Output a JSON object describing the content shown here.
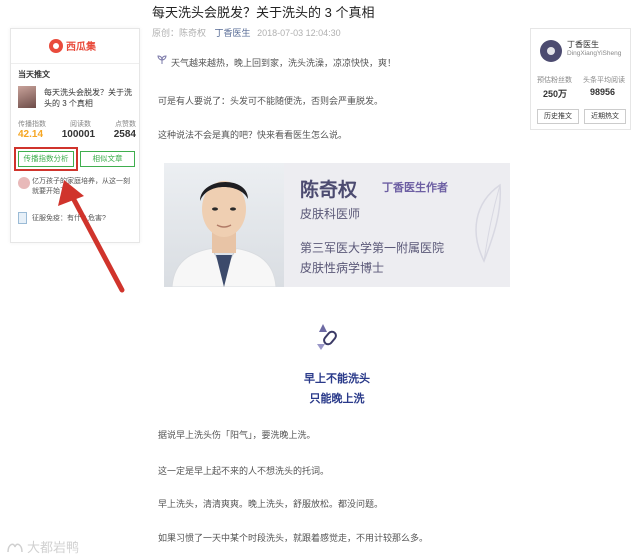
{
  "article": {
    "title": "每天洗头会脱发？关于洗头的 3 个真相",
    "meta": {
      "source": "原创：",
      "author": "陈奇权",
      "account": "丁香医生",
      "date": "2018-07-03 12:04:30"
    },
    "paragraphs": [
      "天气越来越热，晚上回到家，洗头洗澡，凉凉快快，爽！",
      "可是有人要说了：头发可不能随便洗，否则会严重脱发。",
      "这种说法不会是真的吧？快来看看医生怎么说。",
      "据说早上洗头伤「阳气」，要洗晚上洗。",
      "这一定是早上起不来的人不想洗头的托词。",
      "早上洗头，清清爽爽。晚上洗头，舒服放松。都没问题。",
      "如果习惯了一天中某个时段洗头，就跟着感觉走，不用计较那么多。"
    ],
    "author_card": {
      "name": "陈奇权",
      "role": "丁香医生作者",
      "title": "皮肤科医师",
      "org": "第三军医大学第一附属医院",
      "degree": "皮肤性病学博士"
    },
    "section_heading": [
      "早上不能洗头",
      "只能晚上洗"
    ]
  },
  "left_panel": {
    "logo_text": "西瓜集",
    "section_title": "当天推文",
    "article_title": "每天洗头会脱发？关于洗头的 3 个真相",
    "stats_labels": [
      "传播指数",
      "阅读数",
      "点赞数"
    ],
    "stats_values": [
      "42.14",
      "100001",
      "2584"
    ],
    "btn_analysis": "传播指数分析",
    "btn_similar": "相似文章",
    "item2_text": "亿万孩子的家庭培养，从这一刻就要开始了",
    "item3_text": "征服免疫：有什么危害?"
  },
  "right_panel": {
    "name": "丁香医生",
    "wechat_id": "DingXiangYiSheng",
    "label_fans": "预估粉丝数",
    "label_avg": "头条平均阅读",
    "val_fans": "250万",
    "val_avg": "98956",
    "btn_history": "历史推文",
    "btn_recent": "近期热文"
  },
  "watermark": "大都岩鸭",
  "colors": {
    "accent_green": "#3fae4e",
    "highlight_red": "#d0342c",
    "link_blue": "#576b95",
    "orange": "#f5a623",
    "card_purple": "#4c4b70"
  }
}
